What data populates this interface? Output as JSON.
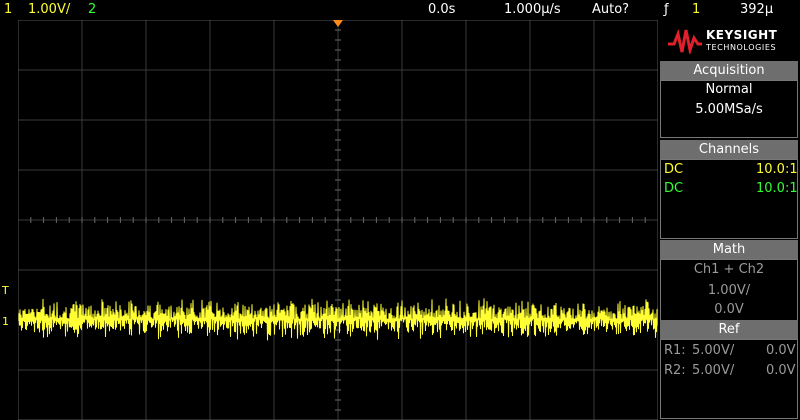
{
  "header": {
    "ch1_label": "1",
    "ch1_scale": "1.00V/",
    "ch2_label": "2",
    "time_delay": "0.0s",
    "time_scale": "1.000µ/s",
    "trigger_mode": "Auto?",
    "trigger_slope": "ƒ",
    "trigger_source": "1",
    "trigger_level": "392µ"
  },
  "colors": {
    "ch1": "#ffff33",
    "ch2": "#33ff33",
    "trigger_marker": "#ff8c1a",
    "panel_header": "#6e6e6e"
  },
  "logo": {
    "brand": "KEYSIGHT",
    "sub": "TECHNOLOGIES"
  },
  "acquisition": {
    "title": "Acquisition",
    "mode": "Normal",
    "rate": "5.00MSa/s"
  },
  "channels": {
    "title": "Channels",
    "rows": [
      {
        "coupling": "DC",
        "probe": "10.0:1"
      },
      {
        "coupling": "DC",
        "probe": "10.0:1"
      }
    ]
  },
  "math": {
    "title": "Math",
    "expr": "Ch1 + Ch2",
    "scale": "1.00V/",
    "offset": "0.0V"
  },
  "ref": {
    "title": "Ref",
    "rows": [
      {
        "name": "R1:",
        "scale": "5.00V/",
        "offset": "0.0V"
      },
      {
        "name": "R2:",
        "scale": "5.00V/",
        "offset": "0.0V"
      }
    ]
  },
  "markers": {
    "trigger": "T",
    "ch1_ground": "1"
  }
}
